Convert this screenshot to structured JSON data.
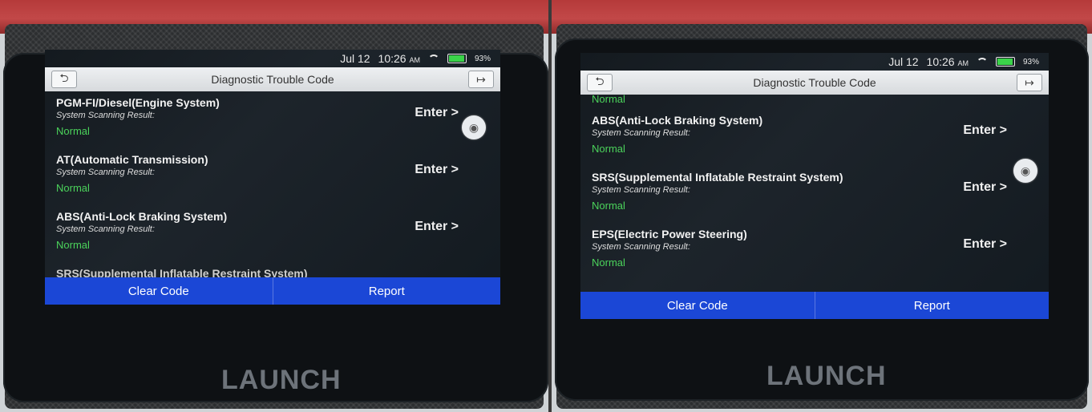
{
  "left_panel": {
    "status_bar": {
      "date": "Jul 12",
      "time": "10:26",
      "ampm": "AM",
      "battery": "93%"
    },
    "header": {
      "title": "Diagnostic Trouble Code",
      "back_icon": "back-arrow-icon",
      "exit_icon": "exit-icon"
    },
    "rows": [
      {
        "name": "PGM-FI/Diesel(Engine System)",
        "scan_label": "System Scanning Result:",
        "status": "Normal",
        "enter": "Enter >"
      },
      {
        "name": "AT(Automatic Transmission)",
        "scan_label": "System Scanning Result:",
        "status": "Normal",
        "enter": "Enter >"
      },
      {
        "name": "ABS(Anti-Lock Braking System)",
        "scan_label": "System Scanning Result:",
        "status": "Normal",
        "enter": "Enter >"
      }
    ],
    "partial_row": {
      "name": "SRS(Supplemental Inflatable Restraint System)"
    },
    "buttons": {
      "clear": "Clear Code",
      "report": "Report"
    },
    "brand": "LAUNCH"
  },
  "right_panel": {
    "status_bar": {
      "date": "Jul 12",
      "time": "10:26",
      "ampm": "AM",
      "battery": "93%"
    },
    "header": {
      "title": "Diagnostic Trouble Code",
      "back_icon": "back-arrow-icon",
      "exit_icon": "exit-icon"
    },
    "top_status": "Normal",
    "rows": [
      {
        "name": "ABS(Anti-Lock Braking System)",
        "scan_label": "System Scanning Result:",
        "status": "Normal",
        "enter": "Enter >"
      },
      {
        "name": "SRS(Supplemental Inflatable Restraint System)",
        "scan_label": "System Scanning Result:",
        "status": "Normal",
        "enter": "Enter >"
      },
      {
        "name": "EPS(Electric Power Steering)",
        "scan_label": "System Scanning Result:",
        "status": "Normal",
        "enter": "Enter >"
      }
    ],
    "buttons": {
      "clear": "Clear Code",
      "report": "Report"
    },
    "brand": "LAUNCH"
  },
  "colors": {
    "normal_status": "#4bd35b",
    "button_bar": "#1b47d6",
    "header_bg": "#e3e5e8"
  }
}
